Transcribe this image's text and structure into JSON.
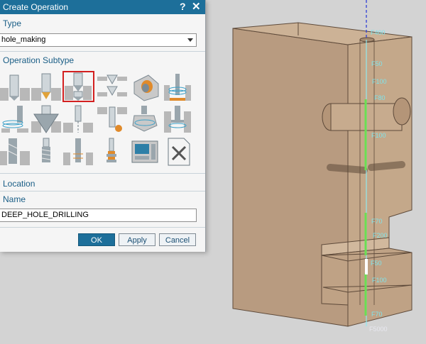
{
  "dialog": {
    "title": "Create Operation",
    "help_glyph": "?",
    "close_glyph": "✕",
    "type_label": "Type",
    "type_value": "hole_making",
    "subtype_label": "Operation Subtype",
    "location_label": "Location",
    "name_label": "Name",
    "name_value": "DEEP_HOLE_DRILLING",
    "ok_label": "OK",
    "apply_label": "Apply",
    "cancel_label": "Cancel"
  },
  "subtype_icons": [
    "spot-face-icon",
    "spot-drill-icon",
    "deep-hole-drilling-icon",
    "back-counterbore-icon",
    "hole-chamfer-icon",
    "thread-milling-feature-icon",
    "hole-milling-icon",
    "countersink-icon",
    "drilling-tool-icon",
    "back-chamfer-icon",
    "boss-milling-icon",
    "groove-milling-icon",
    "hole-reaming-icon",
    "tapping-icon",
    "thread-tapping-icon",
    "boring-icon",
    "cnc-machine-control-icon",
    "user-defined-operation-icon"
  ],
  "viewport": {
    "labels": [
      "F400",
      "F50",
      "F100",
      "F80",
      "F100",
      "F70",
      "F200",
      "F50",
      "F100",
      "F70",
      "F5000"
    ],
    "colors": {
      "part": "#c4a88a",
      "toolpath": "#6adf52",
      "rapid": "#2f3fd6",
      "label": "#7fe3ea"
    }
  }
}
